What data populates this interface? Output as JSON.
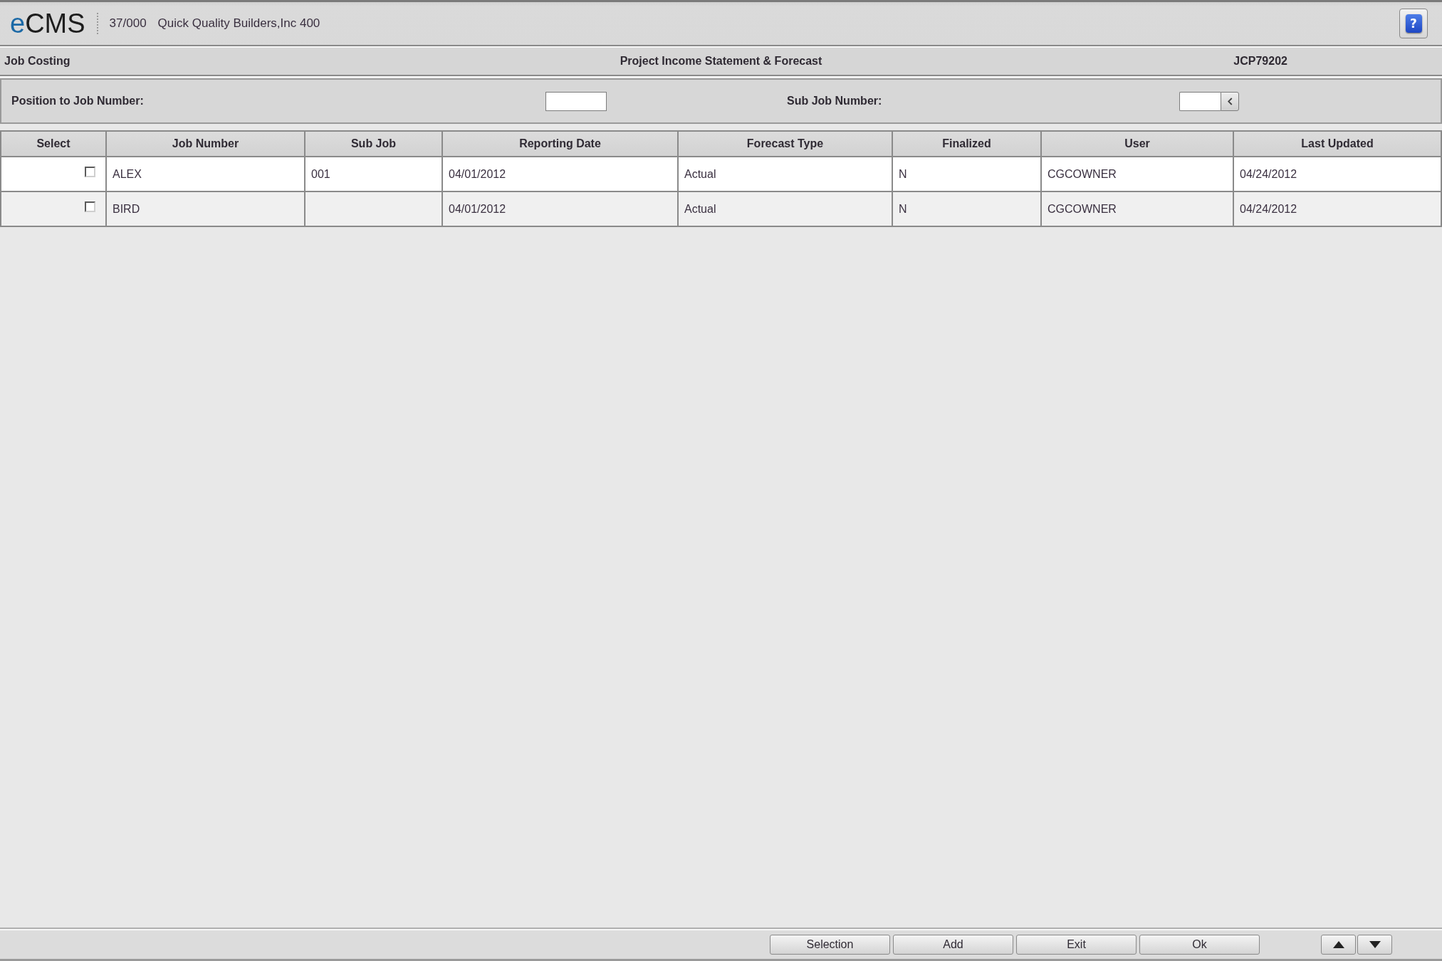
{
  "header": {
    "logo": "eCMS",
    "company_code": "37/000",
    "company_name": "Quick Quality Builders,Inc 400",
    "help_button": "?"
  },
  "title_bar": {
    "module": "Job Costing",
    "title": "Project Income Statement & Forecast",
    "program_id": "JCP79202"
  },
  "filters": [
    {
      "label": "Position to Job Number:",
      "kind": "text"
    },
    {
      "label": "Sub Job Number:",
      "kind": "lookup"
    }
  ],
  "table": {
    "columns": [
      "Select",
      "Job Number",
      "Sub Job",
      "Reporting Date",
      "Forecast Type",
      "Finalized",
      "User",
      "Last Updated"
    ],
    "rows": [
      {
        "checked": false,
        "job_number": "ALEX",
        "sub_job": "001",
        "reporting_date": "04/01/2012",
        "forecast_type": "Actual",
        "finalized": "N",
        "user": "CGCOWNER",
        "last_updated": "04/24/2012"
      },
      {
        "checked": false,
        "job_number": "BIRD",
        "reporting_date": "04/01/2012",
        "forecast_type": "Actual",
        "finalized": "N",
        "user": "CGCOWNER",
        "last_updated": "04/24/2012"
      }
    ]
  },
  "footer": {
    "buttons": [
      "Selection",
      "Add",
      "Exit",
      "Ok"
    ]
  }
}
